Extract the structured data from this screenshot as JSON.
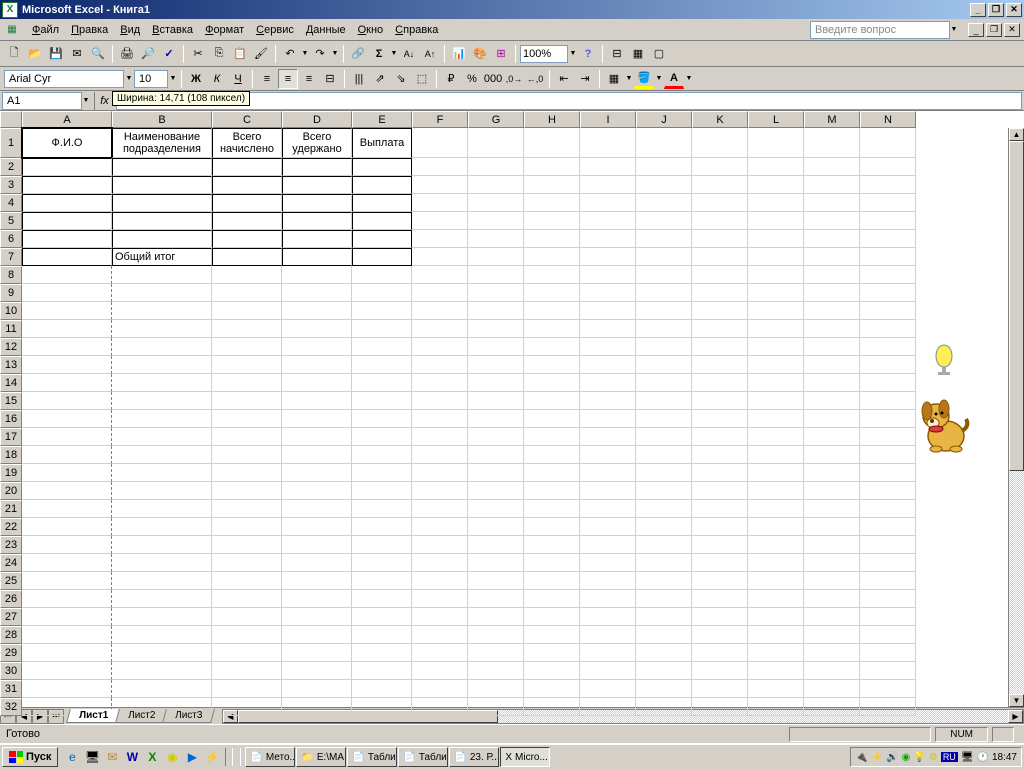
{
  "title": "Microsoft Excel - Книга1",
  "menu": [
    "Файл",
    "Правка",
    "Вид",
    "Вставка",
    "Формат",
    "Сервис",
    "Данные",
    "Окно",
    "Справка"
  ],
  "menu_u": [
    "Ф",
    "П",
    "В",
    "В",
    "Ф",
    "С",
    "Д",
    "О",
    "С"
  ],
  "askbox": "Введите вопрос",
  "font": "Arial Cyr",
  "fontsize": "10",
  "namebox": "A1",
  "zoom": "100%",
  "tooltip": "Ширина: 14,71 (108 пиксел)",
  "cols": {
    "labels": [
      "A",
      "B",
      "C",
      "D",
      "E",
      "F",
      "G",
      "H",
      "I",
      "J",
      "K",
      "L",
      "M",
      "N"
    ],
    "widths": [
      90,
      100,
      70,
      70,
      60,
      56,
      56,
      56,
      56,
      56,
      56,
      56,
      56,
      56
    ]
  },
  "tableRows": 7,
  "totalRows": 32,
  "row1_height": 30,
  "headers": {
    "A": "Ф.И.О",
    "B": "Наименование подразделения",
    "C": "Всего начислено",
    "D": "Всего удержано",
    "E": "Выплата"
  },
  "row7_B": "Общий итог",
  "sheets": [
    "Лист1",
    "Лист2",
    "Лист3"
  ],
  "activeSheet": 0,
  "status": "Готово",
  "numlock": "NUM",
  "taskbar": {
    "start": "Пуск",
    "tasks": [
      "Мето...",
      "E:\\МА...",
      "Табли...",
      "Табли...",
      "23. Р...",
      "Micro..."
    ],
    "activeTask": 5,
    "lang": "RU",
    "clock": "18:47"
  }
}
